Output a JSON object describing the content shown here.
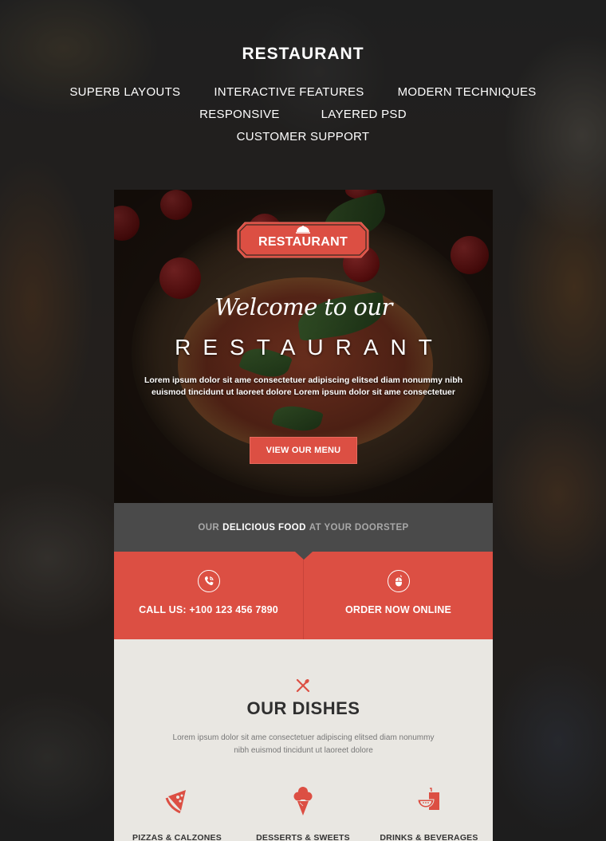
{
  "header": {
    "title": "RESTAURANT",
    "features_row1": [
      "SUPERB LAYOUTS",
      "INTERACTIVE FEATURES",
      "MODERN TECHNIQUES"
    ],
    "features_row2": [
      "RESPONSIVE",
      "LAYERED PSD"
    ],
    "features_row3": [
      "CUSTOMER SUPPORT"
    ]
  },
  "hero": {
    "logo_text": "RESTAURANT",
    "logo_icon": "cloche-icon",
    "welcome": "Welcome to our",
    "title": "RESTAURANT",
    "description_line1": "Lorem ipsum dolor sit ame consectetuer adipiscing elitsed diam nonummy nibh",
    "description_line2": "euismod tincidunt ut laoreet dolore Lorem ipsum dolor sit ame consectetuer",
    "button_label": "VIEW OUR MENU"
  },
  "tagline": {
    "prefix": "OUR",
    "highlight": "DELICIOUS FOOD",
    "suffix": "AT YOUR DOORSTEP"
  },
  "contact": [
    {
      "icon": "phone-icon",
      "label": "CALL US: +100 123 456 7890"
    },
    {
      "icon": "mouse-icon",
      "label": "ORDER NOW ONLINE"
    }
  ],
  "dishes": {
    "icon": "cutlery-icon",
    "title": "OUR DISHES",
    "description_line1": "Lorem ipsum dolor sit ame consectetuer adipiscing elitsed diam nonummy",
    "description_line2": "nibh euismod tincidunt ut laoreet dolore",
    "items": [
      {
        "icon": "pizza-slice-icon",
        "label": "PIZZAS & CALZONES"
      },
      {
        "icon": "ice-cream-icon",
        "label": "DESSERTS & SWEETS"
      },
      {
        "icon": "drink-icon",
        "label": "DRINKS & BEVERAGES"
      }
    ]
  },
  "colors": {
    "accent": "#dc4f43",
    "strip": "#4a4a4a",
    "section_bg": "#e9e7e2",
    "heading": "#2f2f2f"
  }
}
